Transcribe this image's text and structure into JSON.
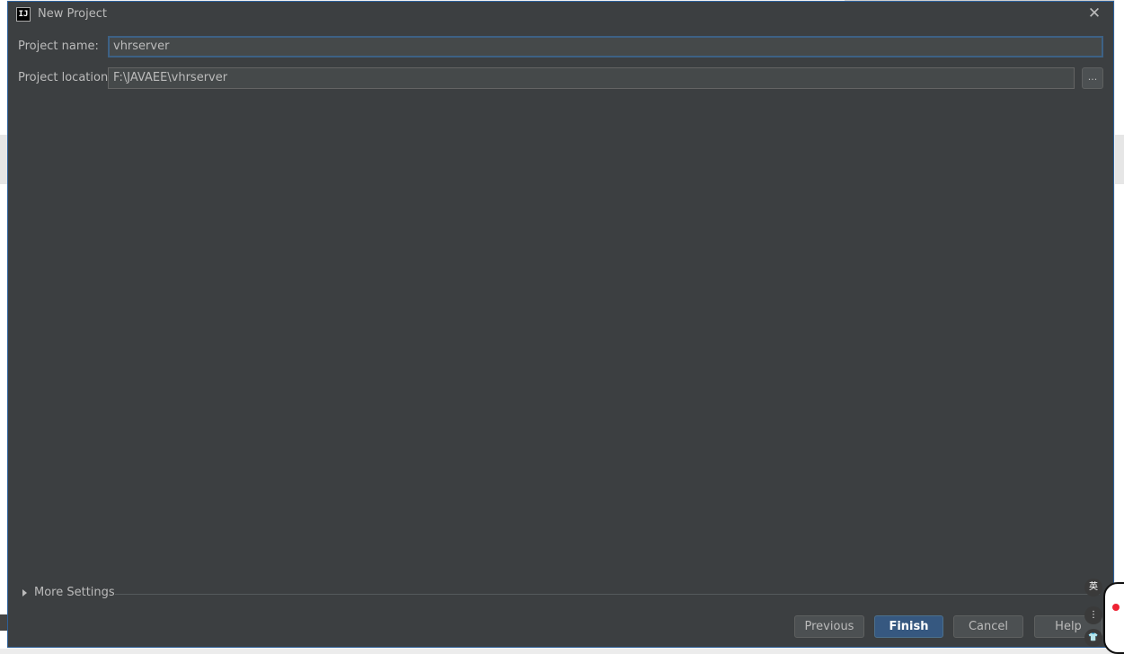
{
  "dialog": {
    "title": "New Project",
    "app_icon_text": "IJ"
  },
  "form": {
    "project_name_label": "Project name:",
    "project_name_value": "vhrserver",
    "project_location_label": "Project location:",
    "project_location_value": "F:\\JAVAEE\\vhrserver",
    "browse_label": "..."
  },
  "more_settings": {
    "label": "More Settings"
  },
  "buttons": {
    "previous": "Previous",
    "finish": "Finish",
    "cancel": "Cancel",
    "help": "Help"
  },
  "ime": {
    "language": "英",
    "menu": "⋮",
    "shirt": "👕"
  },
  "icons": {
    "close": "close-icon",
    "expand": "triangle-right-icon",
    "app": "intellij-icon"
  },
  "colors": {
    "dialog_bg": "#3c3f41",
    "field_bg": "#45494a",
    "focus_border": "#3d6185",
    "primary_button": "#365880",
    "text": "#bbbbbb"
  }
}
